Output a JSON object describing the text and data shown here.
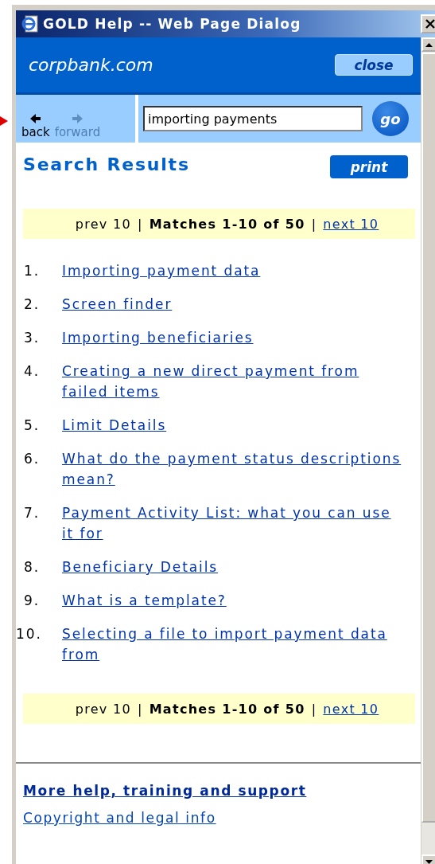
{
  "window": {
    "title": "GOLD Help -- Web Page Dialog"
  },
  "header": {
    "brand": "corpbank.com",
    "close_button": "close"
  },
  "nav": [
    {
      "kind": "back",
      "label": "back",
      "disabled": false
    },
    {
      "kind": "forward",
      "label": "forward",
      "disabled": true
    }
  ],
  "search": {
    "value": "importing payments",
    "button": "go"
  },
  "heading": "Search Results",
  "print_button": "print",
  "pager_top": {
    "prev": "prev 10",
    "separator_1": "|",
    "matches": "Matches 1-10 of 50",
    "separator_2": "|",
    "next": "next 10"
  },
  "results": [
    {
      "number": "1.",
      "title": "Importing payment data"
    },
    {
      "number": "2.",
      "title": "Screen finder"
    },
    {
      "number": "3.",
      "title": "Importing beneficiaries"
    },
    {
      "number": "4.",
      "title": "Creating a new direct payment from failed items"
    },
    {
      "number": "5.",
      "title": "Limit Details"
    },
    {
      "number": "6.",
      "title": "What do the payment status descriptions mean?"
    },
    {
      "number": "7.",
      "title": "Payment Activity List: what you can use it for"
    },
    {
      "number": "8.",
      "title": "Beneficiary Details"
    },
    {
      "number": "9.",
      "title": "What is a template?"
    },
    {
      "number": "10.",
      "title": "Selecting a file to import payment data from"
    }
  ],
  "pager_bottom": {
    "prev": "prev 10",
    "separator_1": "|",
    "matches": "Matches 1-10 of 50",
    "separator_2": "|",
    "next": "next 10"
  },
  "footer_links": [
    {
      "kind": "bold",
      "label": "More help, training and support"
    },
    {
      "kind": "plain",
      "label": "Copyright and legal info"
    }
  ]
}
